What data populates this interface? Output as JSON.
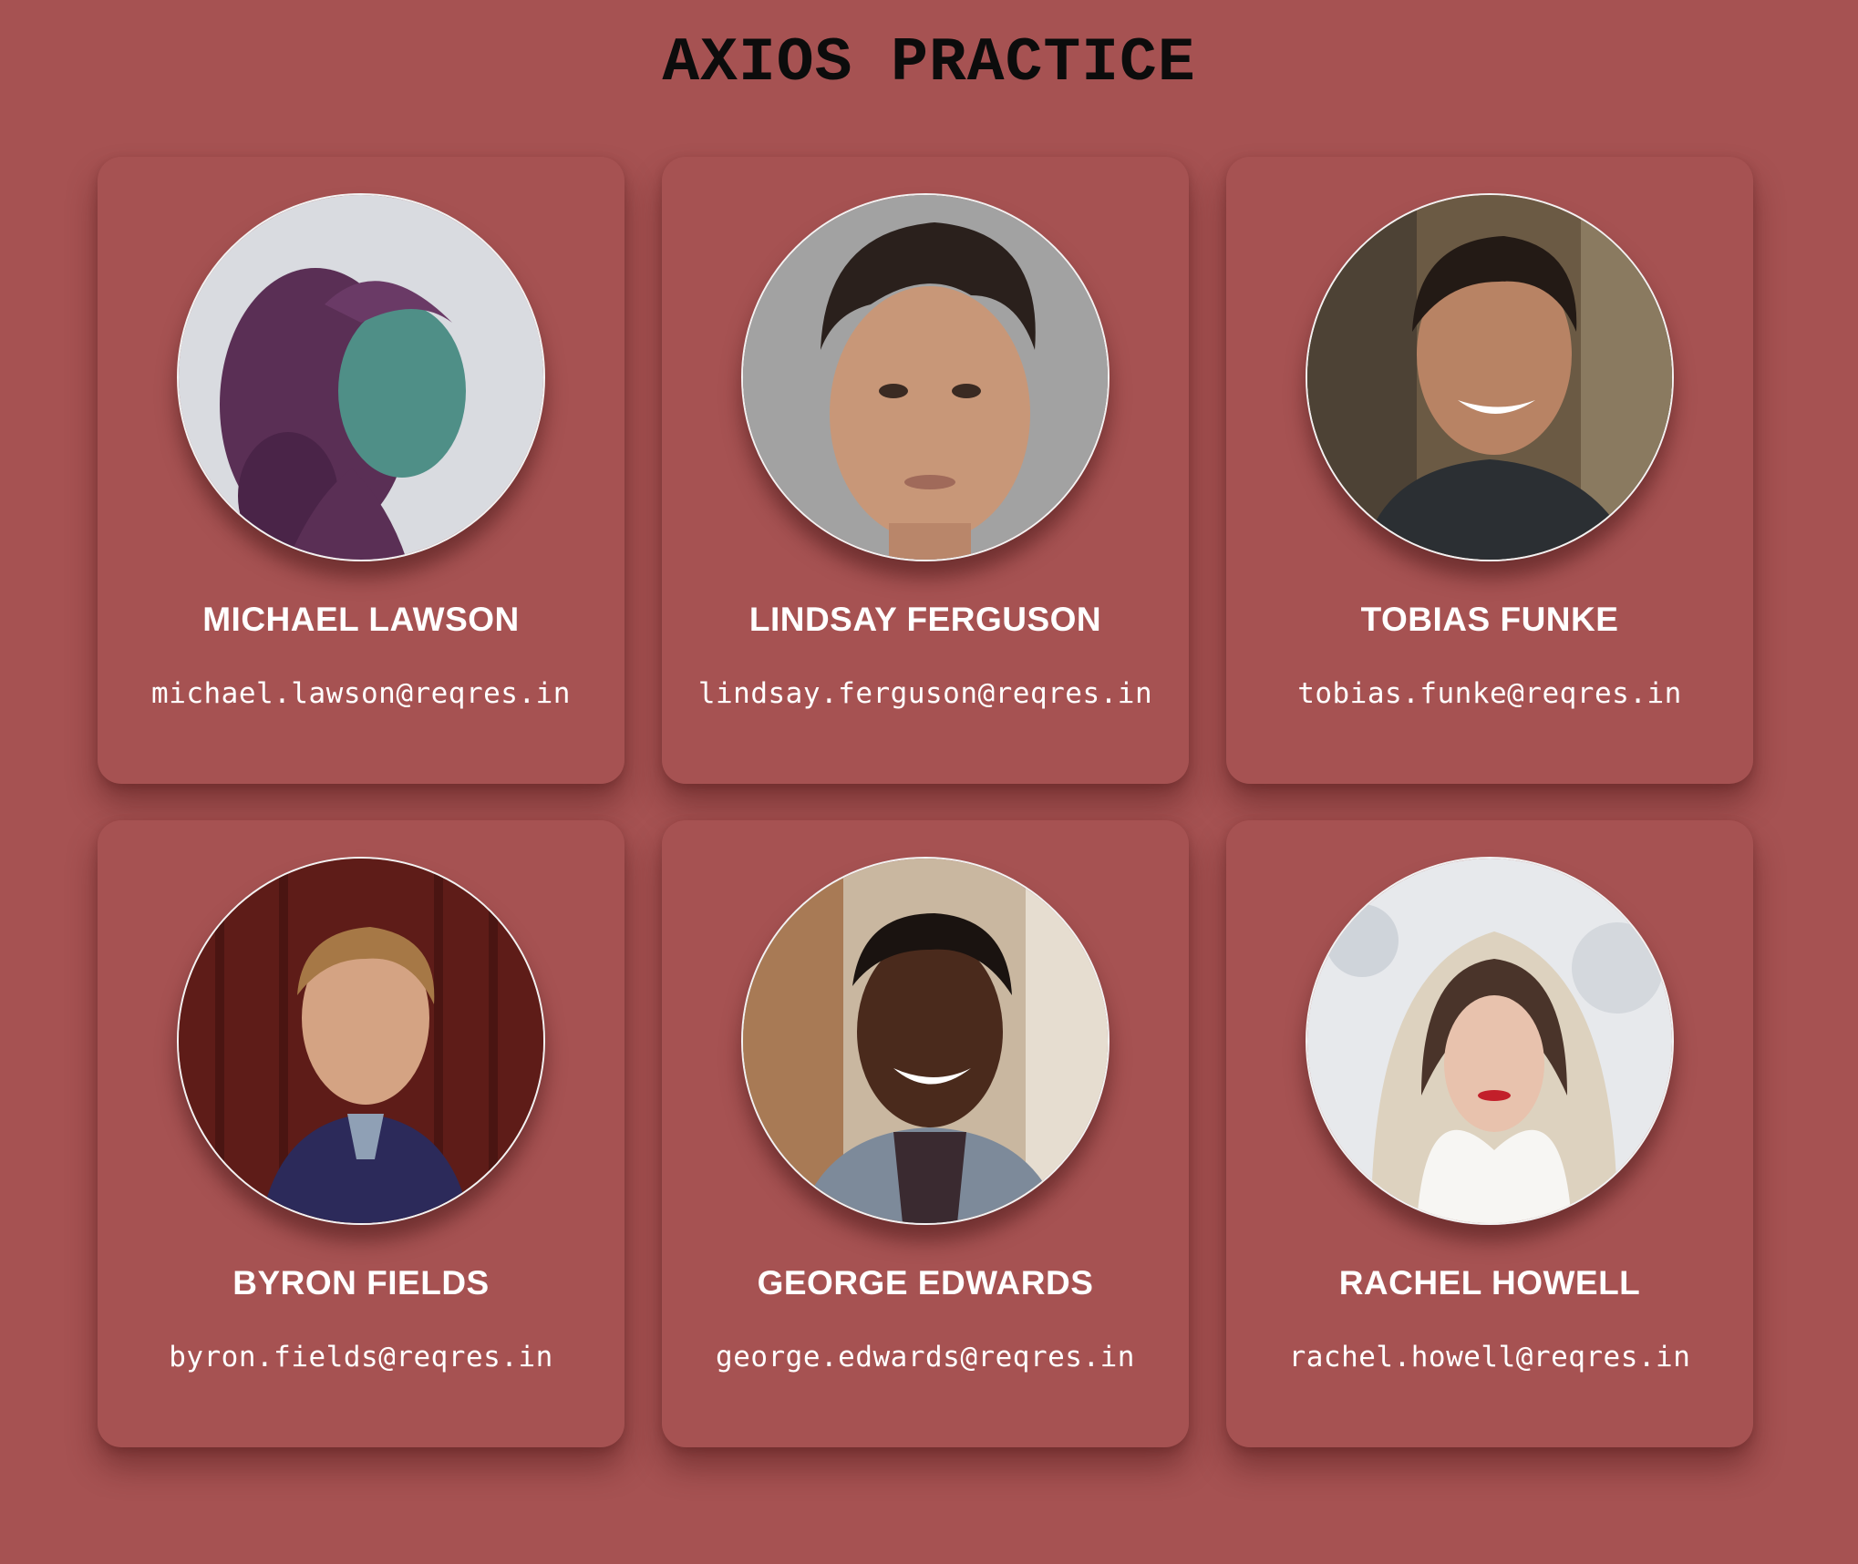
{
  "page": {
    "title": "AXIOS PRACTICE"
  },
  "users": [
    {
      "name": "MICHAEL LAWSON",
      "email": "michael.lawson@reqres.in"
    },
    {
      "name": "LINDSAY FERGUSON",
      "email": "lindsay.ferguson@reqres.in"
    },
    {
      "name": "TOBIAS FUNKE",
      "email": "tobias.funke@reqres.in"
    },
    {
      "name": "BYRON FIELDS",
      "email": "byron.fields@reqres.in"
    },
    {
      "name": "GEORGE EDWARDS",
      "email": "george.edwards@reqres.in"
    },
    {
      "name": "RACHEL HOWELL",
      "email": "rachel.howell@reqres.in"
    }
  ],
  "colors": {
    "background": "#a65252",
    "text": "#ffffff",
    "title": "#0c0c0c"
  }
}
